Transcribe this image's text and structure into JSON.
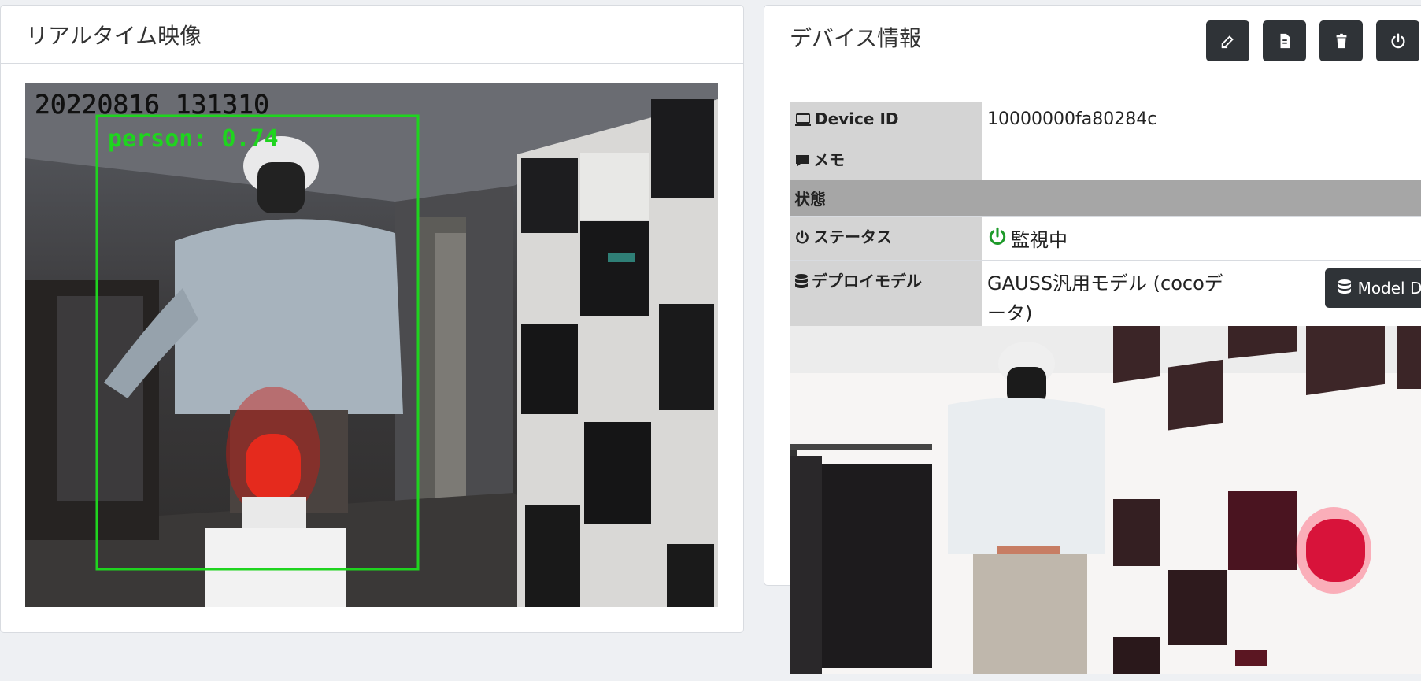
{
  "left_panel": {
    "title": "リアルタイム映像",
    "video": {
      "timestamp": "20220816 131310",
      "detection_label": "person: 0.74",
      "box_color": "#1fd41f"
    }
  },
  "right_panel": {
    "title": "デバイス情報",
    "actions": [
      {
        "name": "edit-icon"
      },
      {
        "name": "file-icon"
      },
      {
        "name": "trash-icon"
      },
      {
        "name": "power-icon"
      }
    ],
    "rows": {
      "device_id": {
        "label": "Device ID",
        "value": "10000000fa80284c"
      },
      "memo": {
        "label": "メモ",
        "value": ""
      },
      "section": "状態",
      "status": {
        "label": "ステータス",
        "value": "監視中",
        "color": "#1e9a2a"
      },
      "model": {
        "label": "デプロイモデル",
        "value": "GAUSS汎用モデル (cocoデータ)",
        "button": "Model Deploy"
      }
    }
  }
}
